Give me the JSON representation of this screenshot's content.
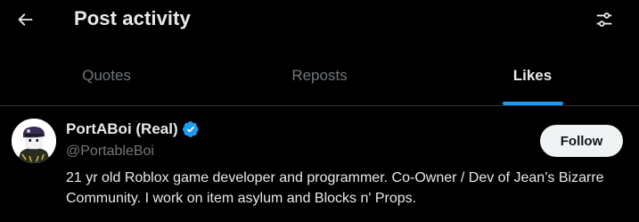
{
  "header": {
    "title": "Post activity",
    "back_icon": "arrow-left-icon",
    "filter_icon": "sliders-icon"
  },
  "tabs": [
    {
      "label": "Quotes",
      "active": false
    },
    {
      "label": "Reposts",
      "active": false
    },
    {
      "label": "Likes",
      "active": true
    }
  ],
  "user": {
    "display_name": "PortABoi (Real)",
    "handle": "@PortableBoi",
    "verified": true,
    "follow_label": "Follow",
    "bio": "21 yr old Roblox game developer and programmer. Co-Owner / Dev of Jean’s Bizarre Community. I work on item asylum and Blocks n' Props."
  },
  "colors": {
    "background": "#000000",
    "accent": "#1d9bf0",
    "text_primary": "#e7e9ea",
    "text_secondary": "#71767b",
    "follow_bg": "#eff3f4"
  }
}
